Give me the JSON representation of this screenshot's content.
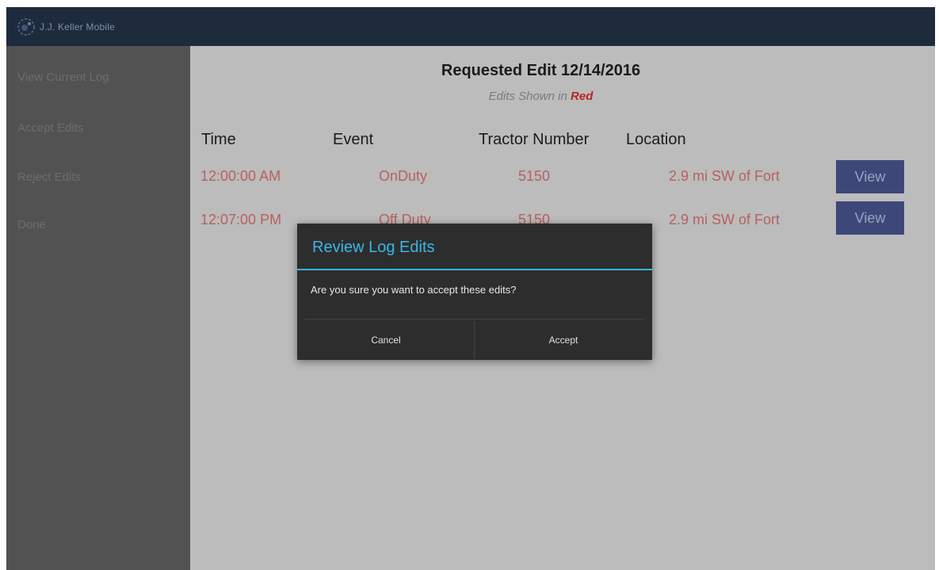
{
  "app": {
    "title": "J.J. Keller Mobile",
    "logo_icon": "globe-icon"
  },
  "sidebar": {
    "items": [
      {
        "label": "View Current Log"
      },
      {
        "label": "Accept Edits"
      },
      {
        "label": "Reject Edits"
      },
      {
        "label": "Done"
      }
    ]
  },
  "main": {
    "title": "Requested Edit 12/14/2016",
    "subtitle_prefix": "Edits Shown in ",
    "subtitle_emphasis": "Red",
    "columns": [
      "Time",
      "Event",
      "Tractor Number",
      "Location"
    ],
    "rows": [
      {
        "time": "12:00:00 AM",
        "event": "OnDuty",
        "tractor": "5150",
        "location": "2.9 mi SW of Fort",
        "action": "View"
      },
      {
        "time": "12:07:00 PM",
        "event": "Off Duty",
        "tractor": "5150",
        "location": "2.9 mi SW of Fort",
        "action": "View"
      }
    ]
  },
  "dialog": {
    "title": "Review Log Edits",
    "message": "Are you sure you want to accept these edits?",
    "cancel_label": "Cancel",
    "accept_label": "Accept"
  },
  "colors": {
    "appbar": "#1d2b3d",
    "accent": "#33b5e5",
    "edit_red": "#d22b2b",
    "view_button": "#2e3d7d"
  }
}
